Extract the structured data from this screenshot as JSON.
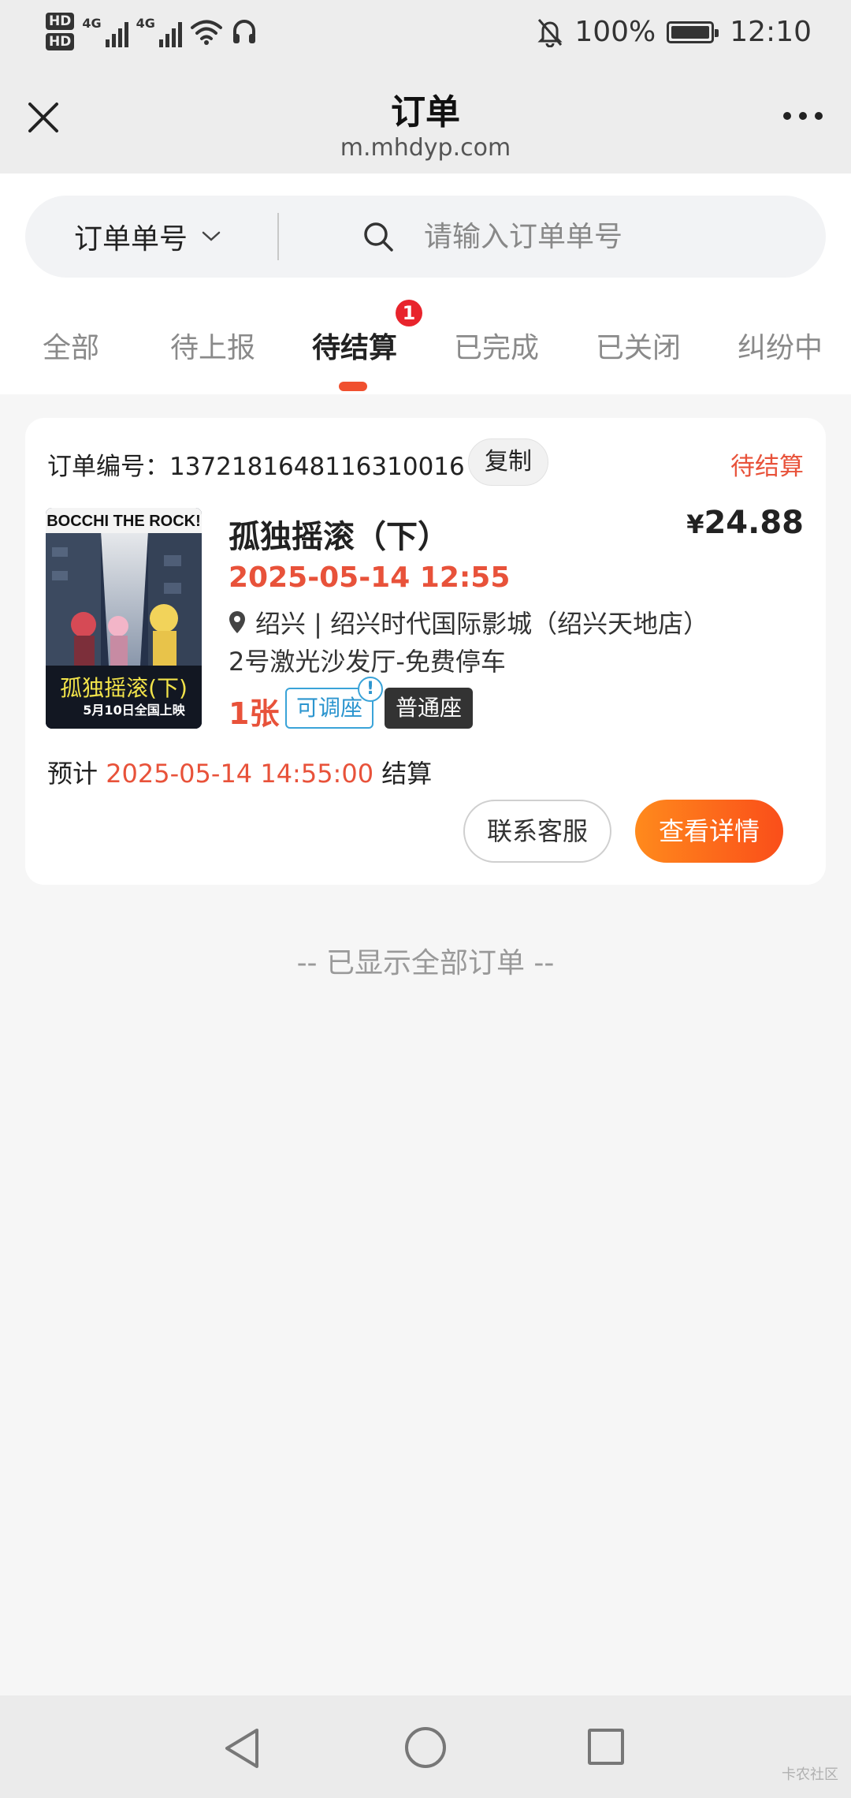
{
  "status_bar": {
    "hd1": "HD",
    "hd2": "HD",
    "net1": "4G",
    "net2": "4G",
    "battery_percent": "100%",
    "time": "12:10"
  },
  "titlebar": {
    "title": "订单",
    "url": "m.mhdyp.com"
  },
  "search": {
    "type_label": "订单单号",
    "placeholder": "请输入订单单号"
  },
  "tabs": [
    {
      "label": "全部"
    },
    {
      "label": "待上报"
    },
    {
      "label": "待结算",
      "badge": "1"
    },
    {
      "label": "已完成"
    },
    {
      "label": "已关闭"
    },
    {
      "label": "纠纷中"
    }
  ],
  "active_tab": "待结算",
  "order": {
    "order_no_label": "订单编号：1372181648116310016",
    "copy_label": "复制",
    "status": "待结算",
    "movie_title": "孤独摇滚（下）",
    "price_symbol": "¥",
    "price": "24.88",
    "showtime": "2025-05-14 12:55",
    "cinema": "绍兴 | 绍兴时代国际影城（绍兴天地店）",
    "hall": "2号激光沙发厅-免费停车",
    "tickets": "1张",
    "tag_adjust": "可调座",
    "tag_info": "!",
    "tag_seat": "普通座",
    "settle_prefix": "预计",
    "settle_time": "2025-05-14 14:55:00",
    "settle_suffix": "结算",
    "contact_label": "联系客服",
    "detail_label": "查看详情",
    "poster": {
      "title_en": "BOCCHI THE ROCK!",
      "title_cn": "孤独摇滚(下)",
      "release": "5月10日全国上映"
    }
  },
  "end_note": "-- 已显示全部订单 --",
  "watermark": "卡农社区",
  "colors": {
    "accent": "#e8523a",
    "tab_indicator": "#f0502f",
    "badge": "#e8242c",
    "detail_gradient_start": "#ff8a1c",
    "detail_gradient_end": "#fa4e1a",
    "tag_blue": "#2c95cf"
  }
}
